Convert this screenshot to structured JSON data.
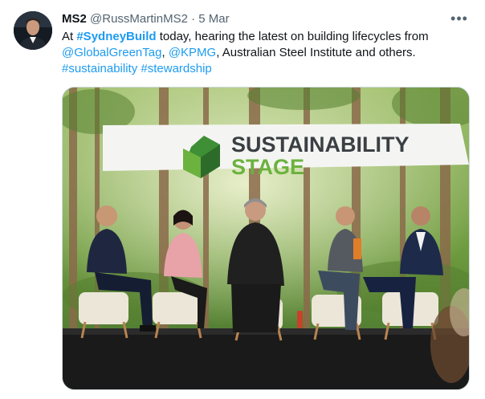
{
  "tweet": {
    "display_name": "MS2",
    "handle": "@RussMartinMS2",
    "separator": "·",
    "timestamp": "5 Mar",
    "more_label": "•••",
    "text": {
      "prefix": "At ",
      "hashtag_event": "#SydneyBuild",
      "middle": " today, hearing the latest on building lifecycles from ",
      "mention_1": "@GlobalGreenTag",
      "comma_1": ", ",
      "mention_2": "@KPMG",
      "tail": ", Australian Steel Institute and others.",
      "hashtag_1": "#sustainability",
      "space": " ",
      "hashtag_2": "#stewardship"
    }
  },
  "media": {
    "banner_line_1": "SUSTAINABILITY",
    "banner_line_2": "STAGE",
    "colors": {
      "banner_dark": "#3a3f44",
      "banner_green": "#6cb23f",
      "link": "#1d9bf0"
    }
  }
}
